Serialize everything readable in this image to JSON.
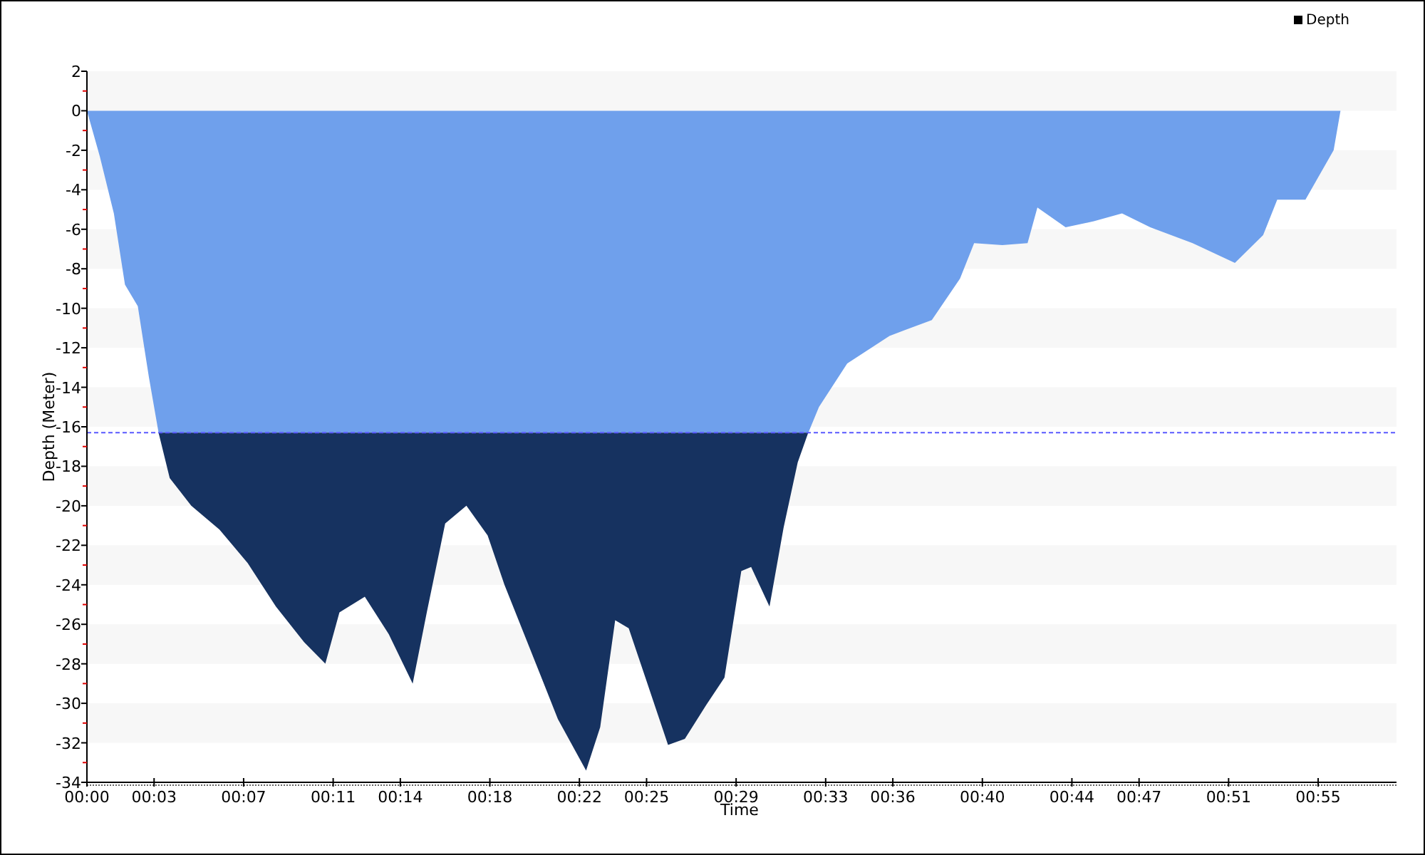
{
  "chart": {
    "chart_data": {
      "type": "area",
      "xlabel": "Time",
      "ylabel": "Depth (Meter)",
      "x": [
        0,
        0.57,
        1.2,
        1.7,
        2.27,
        2.77,
        3.2,
        3.7,
        4.66,
        5.92,
        7.18,
        8.44,
        9.7,
        10.65,
        11.28,
        12.41,
        13.48,
        14.55,
        15.18,
        16.0,
        16.95,
        17.9,
        18.65,
        19.78,
        21.04,
        22.3,
        22.93,
        23.6,
        24.2,
        24.95,
        25.96,
        26.71,
        27.66,
        28.48,
        29.23,
        29.67,
        30.49,
        31.12,
        31.75,
        32.19,
        32.7,
        33.96,
        35.85,
        37.74,
        39.0,
        39.63,
        40.89,
        42.02,
        42.46,
        43.72,
        44.98,
        46.24,
        47.5,
        49.39,
        51.28,
        52.54,
        53.17,
        54.43,
        55.69,
        56.0
      ],
      "series": [
        {
          "name": "Depth",
          "color": "#6fa0ec",
          "values": [
            0,
            -2.3,
            -5.2,
            -8.8,
            -9.9,
            -13.5,
            -16.3,
            -18.6,
            -20.0,
            -21.2,
            -22.9,
            -25.1,
            -26.9,
            -28.0,
            -25.4,
            -24.6,
            -26.5,
            -29.0,
            -25.4,
            -20.9,
            -20.0,
            -21.5,
            -24.0,
            -27.2,
            -30.8,
            -33.4,
            -31.2,
            -25.8,
            -26.2,
            -28.7,
            -32.1,
            -31.8,
            -30.1,
            -28.7,
            -23.3,
            -23.1,
            -25.1,
            -21.1,
            -17.8,
            -16.4,
            -15.0,
            -12.8,
            -11.4,
            -10.6,
            -8.5,
            -6.7,
            -6.8,
            -6.7,
            -4.9,
            -5.9,
            -5.6,
            -5.2,
            -5.9,
            -6.7,
            -7.7,
            -6.3,
            -4.5,
            -4.5,
            -2.0,
            0
          ]
        }
      ],
      "xlim": [
        0,
        58.5
      ],
      "ylim": [
        -34,
        2
      ],
      "xticks": [
        {
          "value": 0,
          "label": "00:00"
        },
        {
          "value": 3,
          "label": "00:03"
        },
        {
          "value": 7,
          "label": "00:07"
        },
        {
          "value": 11,
          "label": "00:11"
        },
        {
          "value": 14,
          "label": "00:14"
        },
        {
          "value": 18,
          "label": "00:18"
        },
        {
          "value": 22,
          "label": "00:22"
        },
        {
          "value": 25,
          "label": "00:25"
        },
        {
          "value": 29,
          "label": "00:29"
        },
        {
          "value": 33,
          "label": "00:33"
        },
        {
          "value": 36,
          "label": "00:36"
        },
        {
          "value": 40,
          "label": "00:40"
        },
        {
          "value": 44,
          "label": "00:44"
        },
        {
          "value": 47,
          "label": "00:47"
        },
        {
          "value": 51,
          "label": "00:51"
        },
        {
          "value": 55,
          "label": "00:55"
        }
      ],
      "yticks": [
        2,
        0,
        -2,
        -4,
        -6,
        -8,
        -10,
        -12,
        -14,
        -16,
        -18,
        -20,
        -22,
        -24,
        -26,
        -28,
        -30,
        -32,
        -34
      ],
      "ref_lines": [
        {
          "axis": "y",
          "value": -16.3,
          "color": "#5a5aff"
        }
      ]
    }
  }
}
